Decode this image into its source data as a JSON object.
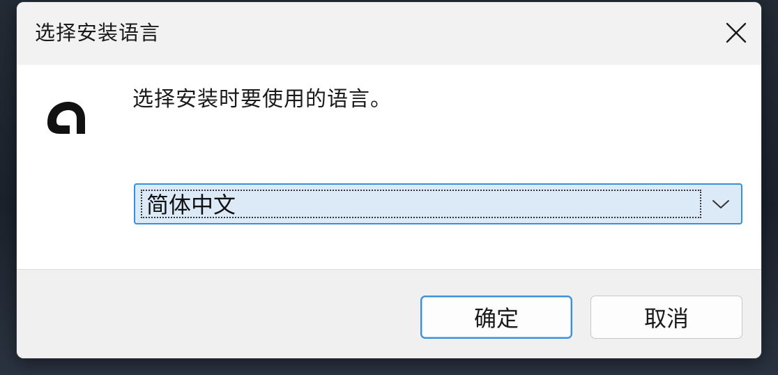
{
  "dialog": {
    "title": "选择安装语言",
    "close_icon": "close-icon"
  },
  "content": {
    "app_icon": "app-logo-icon",
    "prompt": "选择安装时要使用的语言。",
    "language_select": {
      "selected_value": "简体中文",
      "dropdown_icon": "chevron-down-icon"
    }
  },
  "footer": {
    "ok_label": "确定",
    "cancel_label": "取消"
  },
  "colors": {
    "accent": "#3b8fd9",
    "select_background": "#dce9f7",
    "footer_background": "#f0f0f0"
  }
}
